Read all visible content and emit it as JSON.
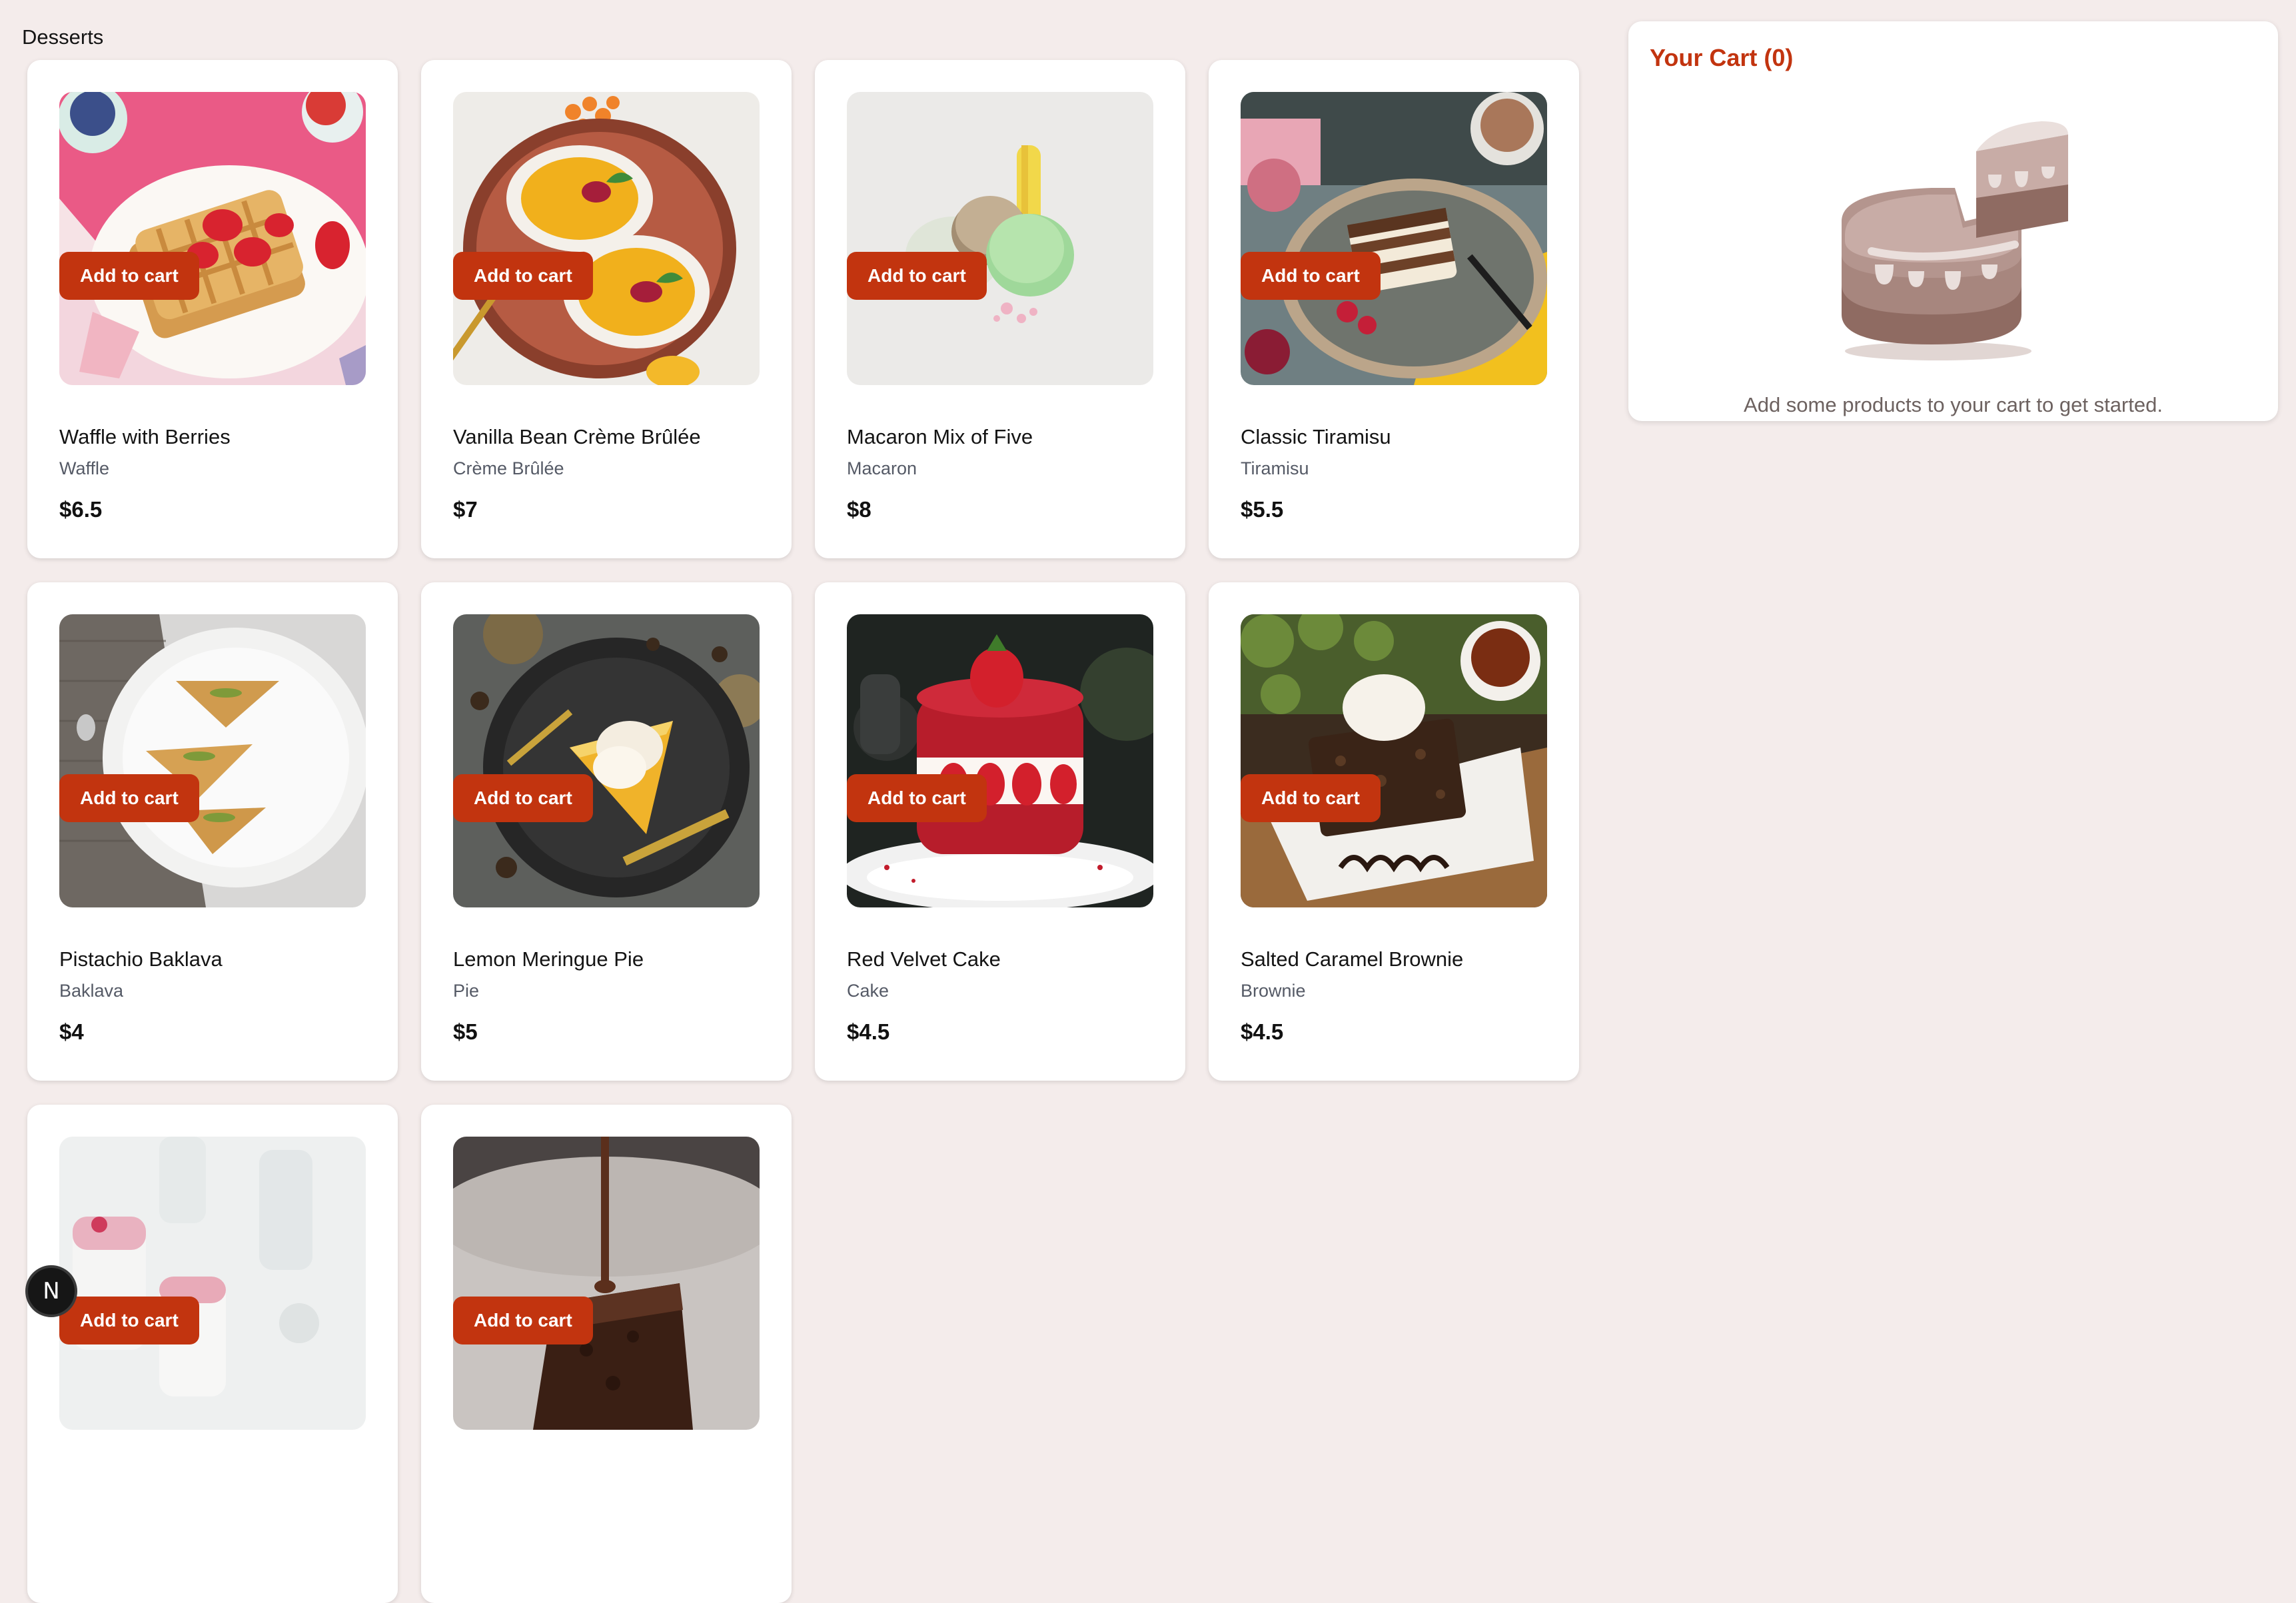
{
  "page": {
    "title": "Desserts"
  },
  "products": [
    {
      "name": "Waffle with Berries",
      "category": "Waffle",
      "price": "$6.5",
      "image": "waffle",
      "button": "Add to cart"
    },
    {
      "name": "Vanilla Bean Crème Brûlée",
      "category": "Crème Brûlée",
      "price": "$7",
      "image": "creme-brulee",
      "button": "Add to cart"
    },
    {
      "name": "Macaron Mix of Five",
      "category": "Macaron",
      "price": "$8",
      "image": "macaron",
      "button": "Add to cart"
    },
    {
      "name": "Classic Tiramisu",
      "category": "Tiramisu",
      "price": "$5.5",
      "image": "tiramisu",
      "button": "Add to cart"
    },
    {
      "name": "Pistachio Baklava",
      "category": "Baklava",
      "price": "$4",
      "image": "baklava",
      "button": "Add to cart"
    },
    {
      "name": "Lemon Meringue Pie",
      "category": "Pie",
      "price": "$5",
      "image": "lemon-pie",
      "button": "Add to cart"
    },
    {
      "name": "Red Velvet Cake",
      "category": "Cake",
      "price": "$4.5",
      "image": "red-velvet",
      "button": "Add to cart"
    },
    {
      "name": "Salted Caramel Brownie",
      "category": "Brownie",
      "price": "$4.5",
      "image": "brownie",
      "button": "Add to cart"
    },
    {
      "name": "",
      "category": "",
      "price": "",
      "image": "panna-cotta",
      "button": "Add to cart"
    },
    {
      "name": "",
      "category": "",
      "price": "",
      "image": "chocolate-cake",
      "button": "Add to cart"
    }
  ],
  "cart": {
    "title": "Your Cart (0)",
    "empty_message": "Add some products to your cart to get started.",
    "illustration": "empty-cart-cake-icon"
  },
  "badge": {
    "label": "N",
    "icon": "nextjs-logo-icon"
  },
  "colors": {
    "accent": "#c2340f",
    "background": "#f4eceb",
    "card": "#ffffff",
    "muted_text": "#555a66"
  }
}
